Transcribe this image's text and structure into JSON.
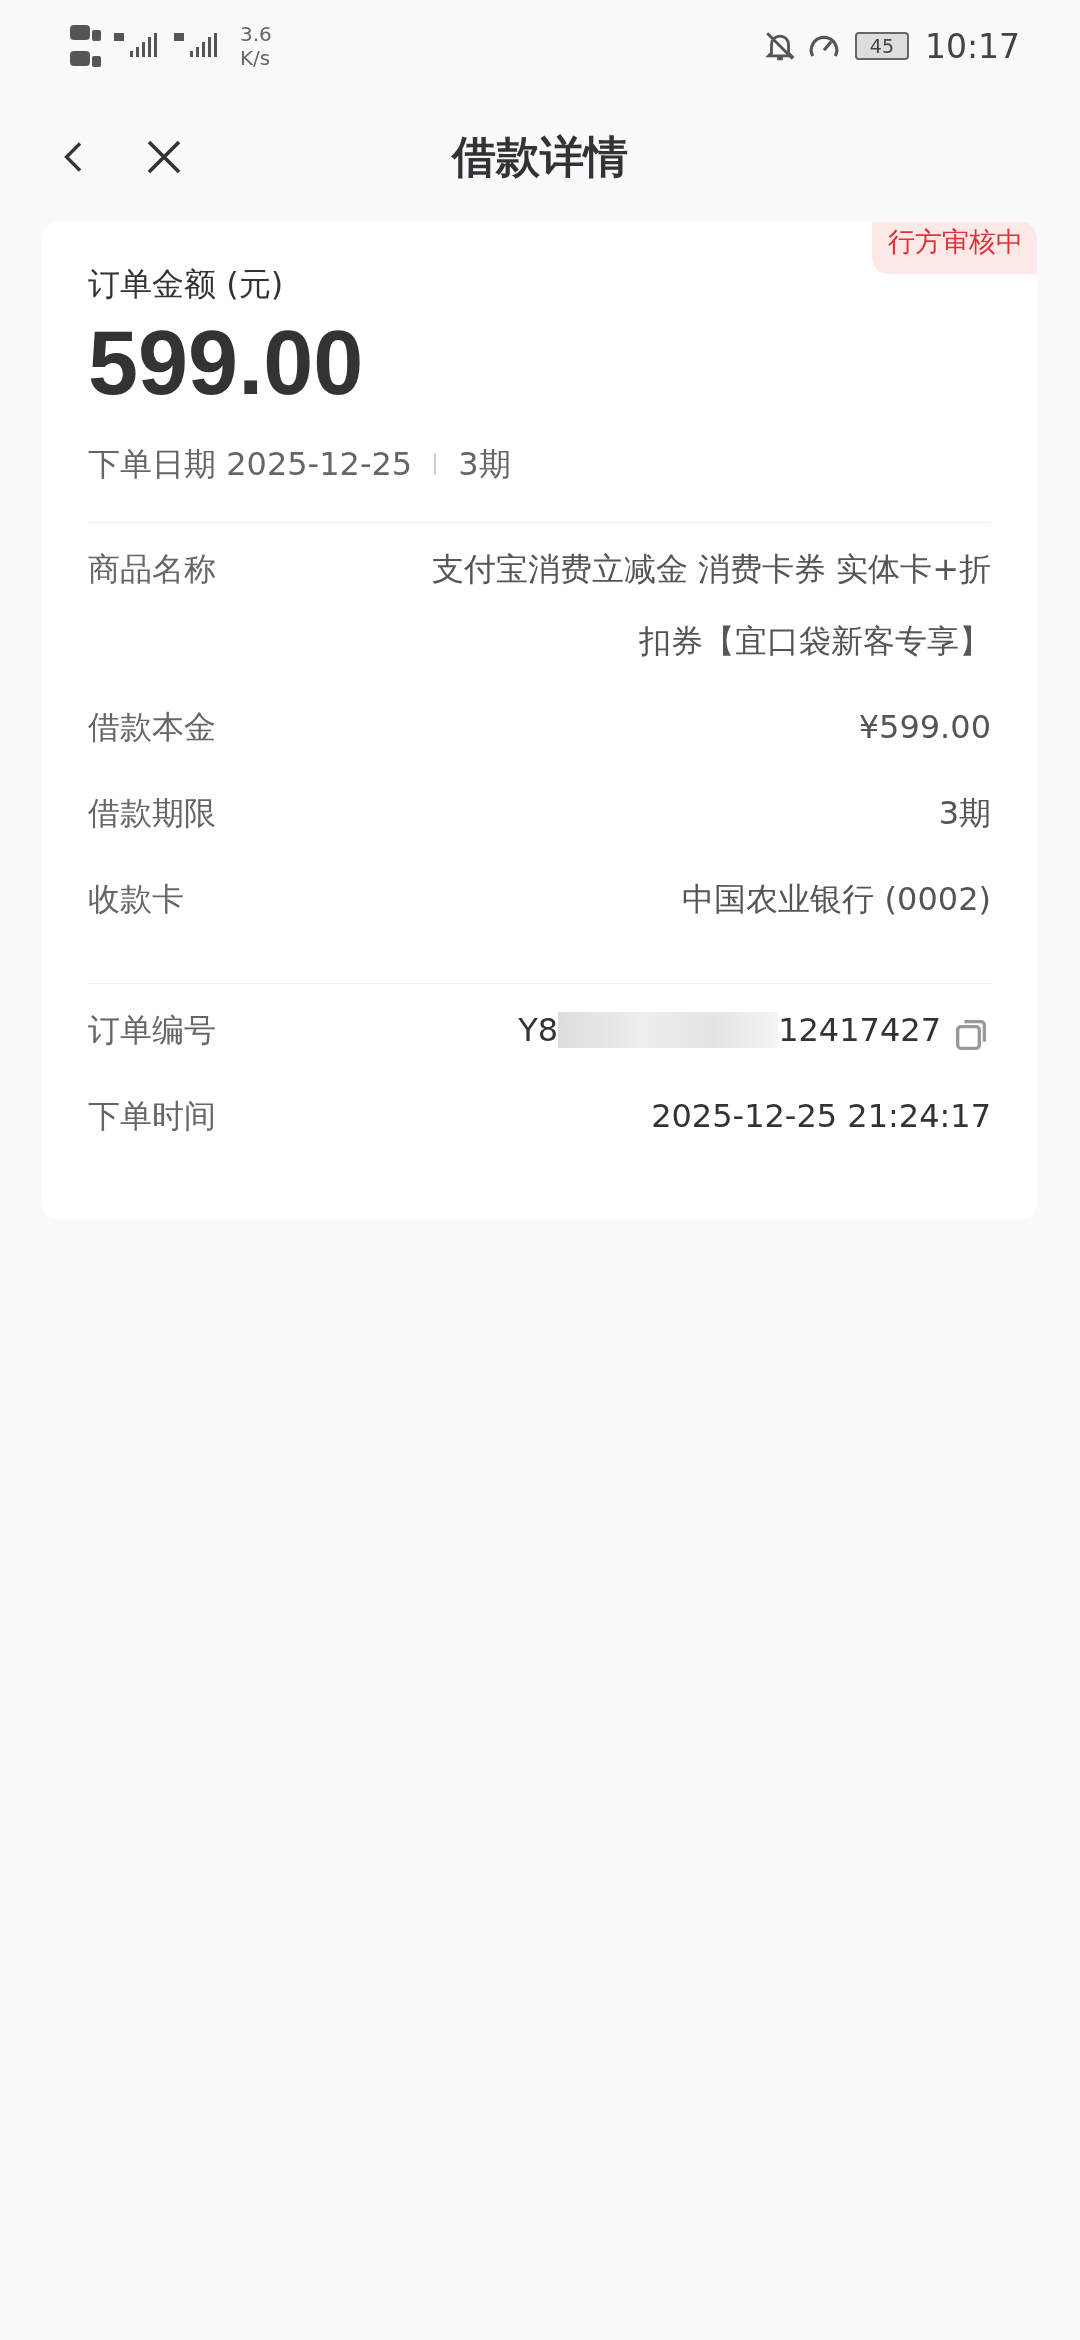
{
  "status_bar": {
    "speed_value": "3.6",
    "speed_unit": "K/s",
    "battery": "45",
    "time": "10:17"
  },
  "header": {
    "title": "借款详情"
  },
  "summary": {
    "badge": "行方审核中",
    "amount_label": "订单金额 (元)",
    "amount": "599.00",
    "date_text": "下单日期 2025-12-25",
    "term": "3期"
  },
  "details": [
    {
      "label": "商品名称",
      "value": "支付宝消费立减金 消费卡券 实体卡+折扣券【宜口袋新客专享】"
    },
    {
      "label": "借款本金",
      "value": "¥599.00"
    },
    {
      "label": "借款期限",
      "value": "3期"
    },
    {
      "label": "收款卡",
      "value": "中国农业银行 (0002)"
    }
  ],
  "order": [
    {
      "kind": "redacted",
      "label": "订单编号",
      "value_start": "Y8",
      "value_end": "12417427"
    },
    {
      "kind": "plain",
      "label": "下单时间",
      "value": "2025-12-25 21:24:17"
    }
  ]
}
